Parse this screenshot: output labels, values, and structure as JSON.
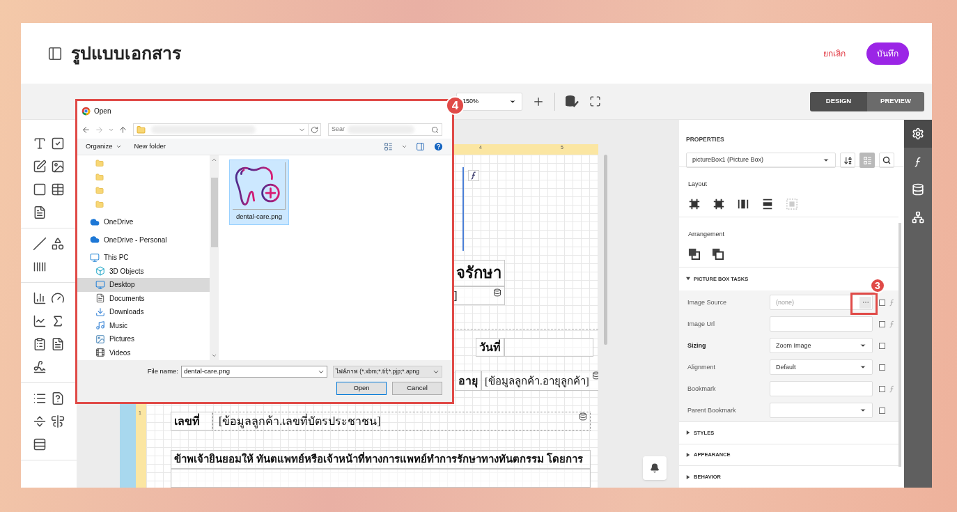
{
  "header": {
    "title": "รูปแบบเอกสาร",
    "cancel": "ยกเลิก",
    "save": "บันทึก"
  },
  "toolbar": {
    "zoom": "150%",
    "modes": [
      {
        "label": "DESIGN",
        "selected": true
      },
      {
        "label": "PREVIEW",
        "selected": false
      }
    ]
  },
  "ruler": {
    "top_ticks": [
      "4",
      "5"
    ],
    "side_tick": "1"
  },
  "report": {
    "title_fragment": "จรักษา",
    "title_sub_fragment": "]",
    "date_label": "วันที่",
    "age_label": "อายุ",
    "age_value": "[ข้อมูลลูกค้า.อายุลูกค้า]",
    "id_label": "เลขที่",
    "id_value": "[ข้อมูลลูกค้า.เลขที่บัตรประชาชน]",
    "consent": "ข้าพเจ้ายินยอมให้ ทันตแพทย์หรือเจ้าหน้าที่ทางการแพทย์ทำการรักษาทางทันตกรรม โดยการ"
  },
  "properties": {
    "heading": "PROPERTIES",
    "selector": "pictureBox1 (Picture Box)",
    "categorized": true,
    "layout_label": "Layout",
    "arrangement_label": "Arrangement",
    "tasks": {
      "title": "PICTURE BOX TASKS",
      "expanded": true,
      "step": "3",
      "rows": [
        {
          "label": "Image Source",
          "kind": "picker",
          "placeholder": "(none)",
          "modified": false,
          "expression": true,
          "checked": false
        },
        {
          "label": "Image Url",
          "kind": "text",
          "modified": false,
          "expression": true,
          "checked": false
        },
        {
          "label": "Sizing",
          "kind": "select",
          "value": "Zoom Image",
          "modified": true,
          "expression": false,
          "checked": false
        },
        {
          "label": "Alignment",
          "kind": "select",
          "value": "Default",
          "modified": false,
          "expression": false,
          "checked": false
        },
        {
          "label": "Bookmark",
          "kind": "text",
          "modified": false,
          "expression": true,
          "checked": false
        },
        {
          "label": "Parent Bookmark",
          "kind": "select",
          "modified": false,
          "expression": false,
          "checked": false
        }
      ]
    },
    "sections": [
      {
        "title": "STYLES",
        "expanded": false
      },
      {
        "title": "APPEARANCE",
        "expanded": false
      },
      {
        "title": "BEHAVIOR",
        "expanded": false
      }
    ]
  },
  "rail": [
    {
      "selected": true
    },
    {
      "selected": false
    },
    {
      "selected": false
    },
    {
      "selected": false
    }
  ],
  "dialog": {
    "title": "Open",
    "step": "4",
    "search_placeholder": "Sear",
    "organize": "Organize",
    "new_folder": "New folder",
    "nav": [
      {
        "label": "OneDrive",
        "kind": "cloud",
        "selected": false
      },
      {
        "label": "OneDrive - Personal",
        "kind": "cloud",
        "selected": false
      },
      {
        "label": "This PC",
        "kind": "pc",
        "selected": false,
        "children": [
          {
            "label": "3D Objects",
            "kind": "objects",
            "selected": false
          },
          {
            "label": "Desktop",
            "kind": "desktop",
            "selected": true
          },
          {
            "label": "Documents",
            "kind": "documents",
            "selected": false
          },
          {
            "label": "Downloads",
            "kind": "downloads",
            "selected": false
          },
          {
            "label": "Music",
            "kind": "music",
            "selected": false
          },
          {
            "label": "Pictures",
            "kind": "pictures",
            "selected": false
          },
          {
            "label": "Videos",
            "kind": "videos",
            "selected": false
          }
        ]
      }
    ],
    "files": [
      {
        "name": "dental-care.png",
        "selected": true
      }
    ],
    "file_name_label": "File name:",
    "file_name": "dental-care.png",
    "filter": "ไฟล์ภาพ (*.xbm;*.tif;*.pjp;*.apng",
    "buttons": [
      "Open",
      "Cancel"
    ]
  }
}
